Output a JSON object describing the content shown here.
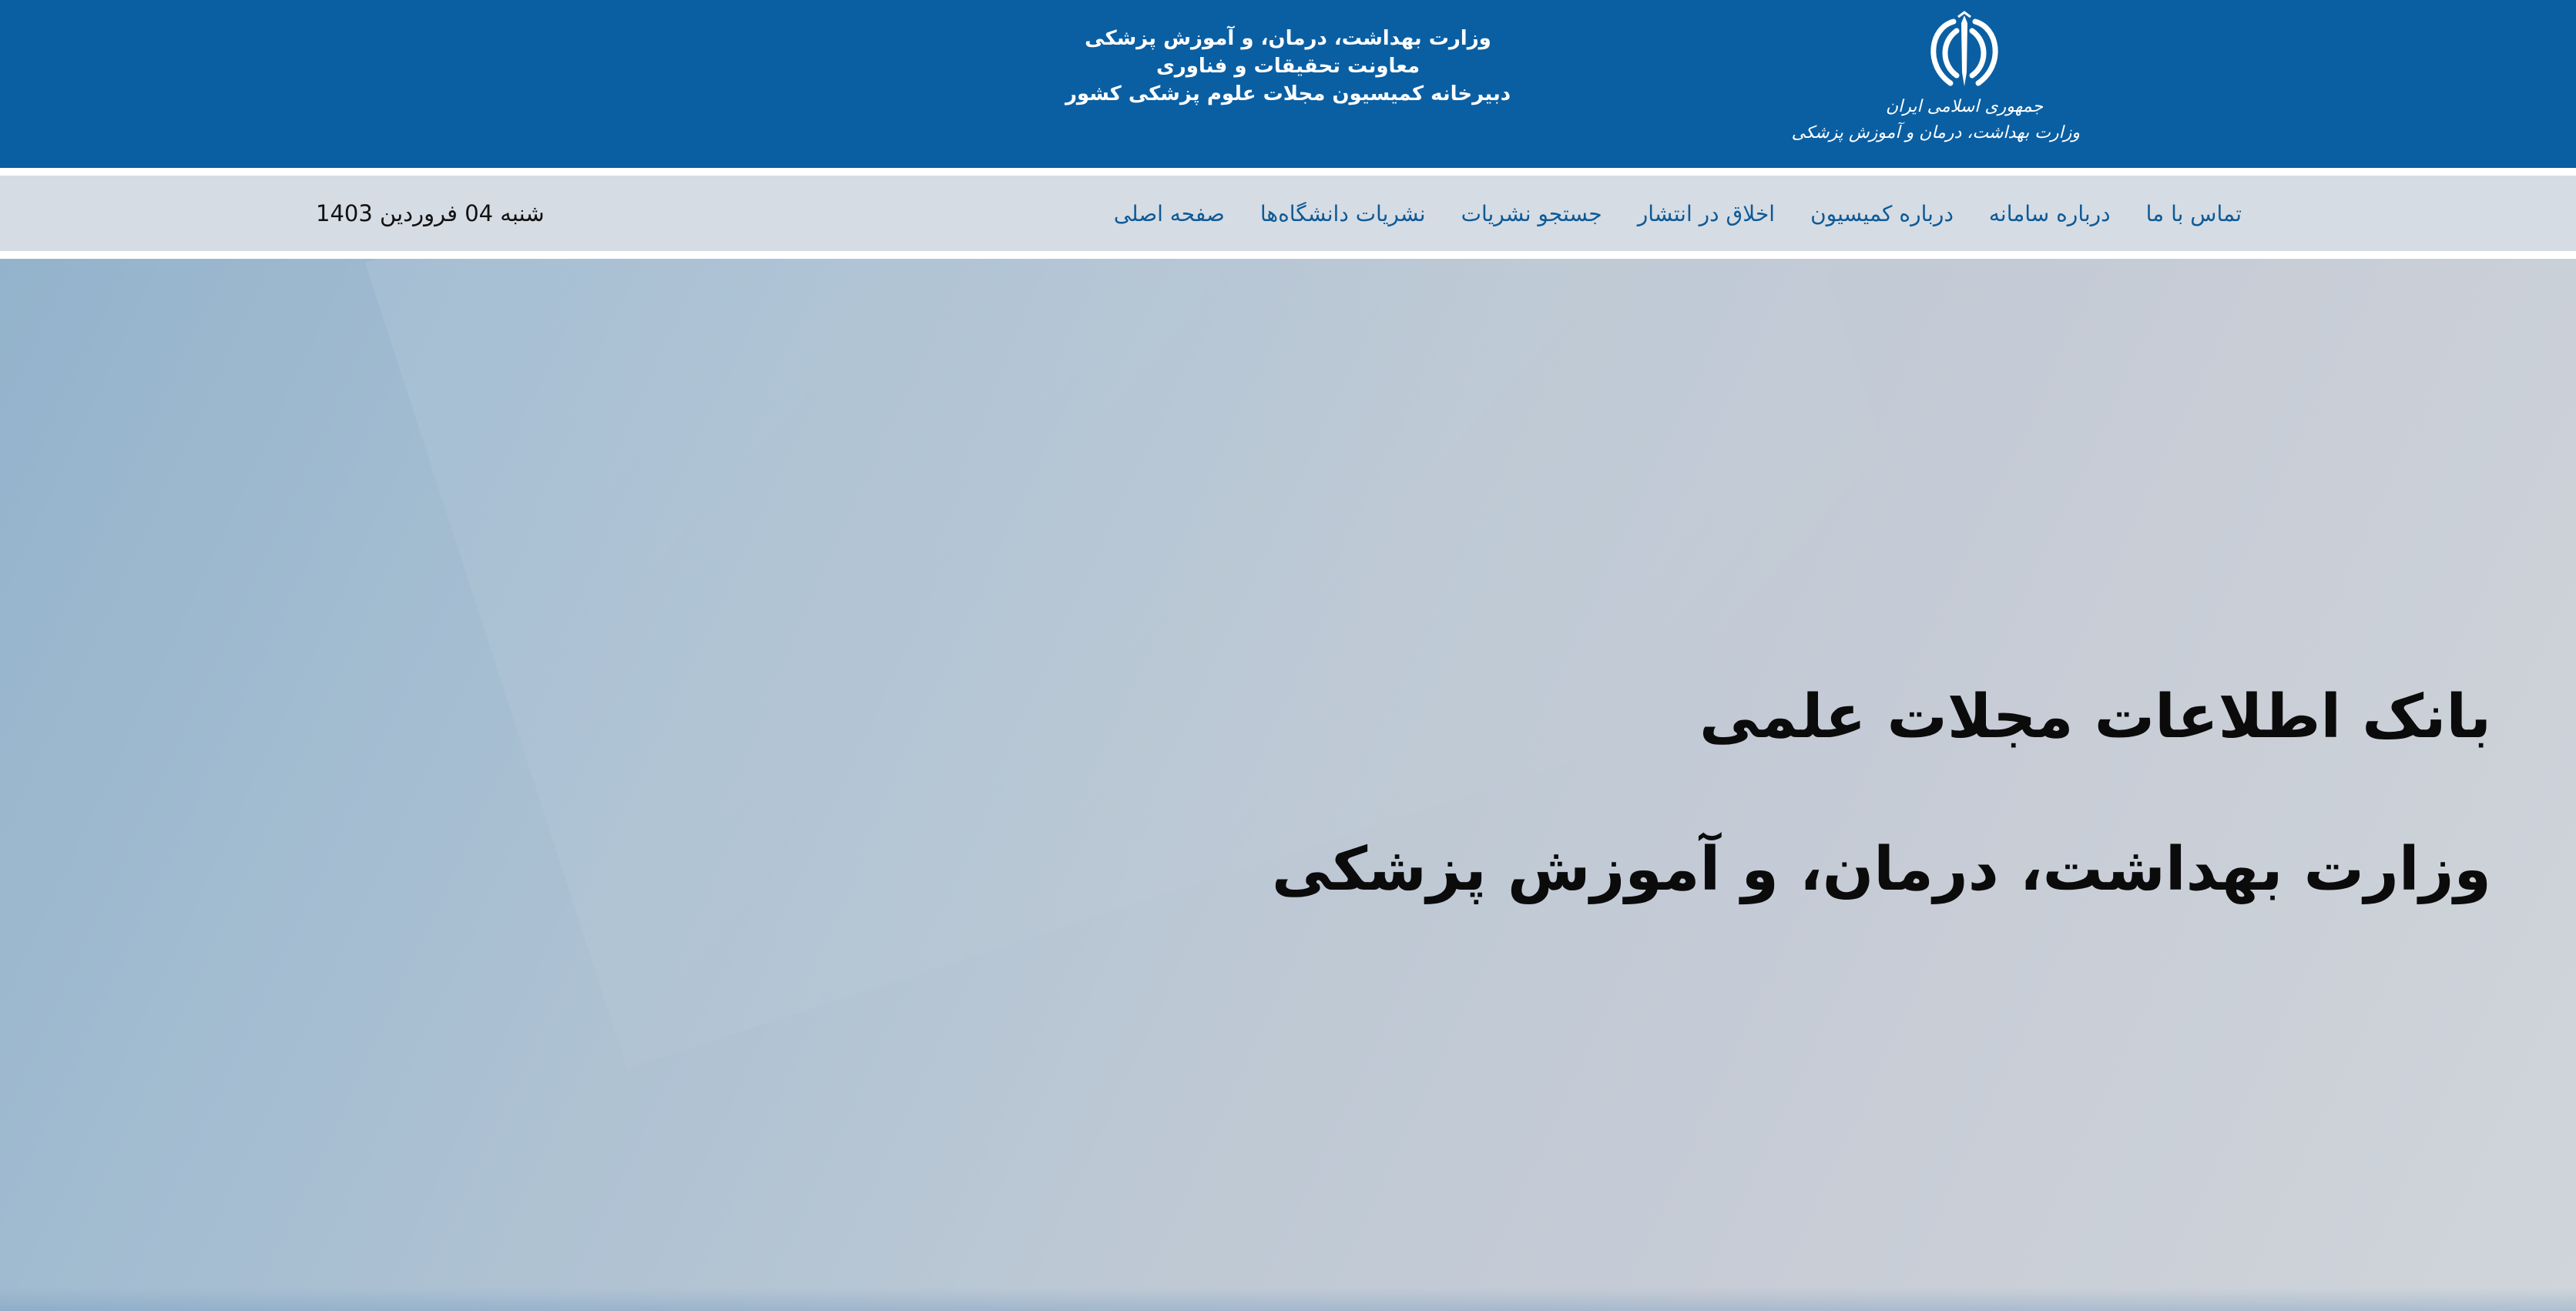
{
  "header": {
    "emblem": {
      "icon": "iran-emblem-icon",
      "line1": "جمهوری اسلامی ایران",
      "line2": "وزارت بهداشت، درمان و آموزش پزشکی"
    },
    "titles": [
      "وزارت بهداشت، درمان، و آموزش پزشکی",
      "معاونت تحقیقات و فناوری",
      "دبیرخانه کمیسیون مجلات علوم پزشکی کشور"
    ]
  },
  "nav": {
    "items": [
      {
        "label": "صفحه اصلی"
      },
      {
        "label": "نشریات دانشگاه‌ها"
      },
      {
        "label": "جستجو نشریات"
      },
      {
        "label": "اخلاق در انتشار"
      },
      {
        "label": "درباره کمیسیون"
      },
      {
        "label": "درباره سامانه"
      },
      {
        "label": "تماس با ما"
      }
    ],
    "date": "شنبه 04 فروردین 1403"
  },
  "hero": {
    "title1": "بانک اطلاعات مجلات علمی",
    "title2": "وزارت بهداشت، درمان، و آموزش پزشکی"
  },
  "colors": {
    "header_bg": "#0a5fa3",
    "nav_bg": "#d6dce4",
    "nav_link": "#0e5a96"
  }
}
